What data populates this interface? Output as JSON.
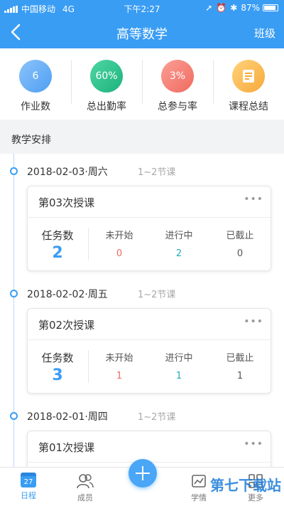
{
  "status_bar": {
    "carrier": "中国移动",
    "network": "4G",
    "time": "下午2:27",
    "battery": "87%"
  },
  "nav": {
    "title": "高等数学",
    "right_label": "班级"
  },
  "stats": [
    {
      "value": "6",
      "label": "作业数",
      "color": "#5aa8f5"
    },
    {
      "value": "60%",
      "label": "总出勤率",
      "color": "#1fbf8a"
    },
    {
      "value": "3%",
      "label": "总参与率",
      "color": "#f27b71"
    },
    {
      "value": "",
      "label": "课程总结",
      "icon": "document-icon",
      "color": "#f9b84a"
    }
  ],
  "section_title": "教学安排",
  "schedule": [
    {
      "date": "2018-02-03·周六",
      "period": "1~2节课",
      "title": "第03次授课",
      "task_label": "任务数",
      "task_count": "2",
      "columns": [
        {
          "label": "未开始",
          "value": "0"
        },
        {
          "label": "进行中",
          "value": "2"
        },
        {
          "label": "已截止",
          "value": "0"
        }
      ]
    },
    {
      "date": "2018-02-02·周五",
      "period": "1~2节课",
      "title": "第02次授课",
      "task_label": "任务数",
      "task_count": "3",
      "columns": [
        {
          "label": "未开始",
          "value": "1"
        },
        {
          "label": "进行中",
          "value": "1"
        },
        {
          "label": "已截止",
          "value": "1"
        }
      ]
    },
    {
      "date": "2018-02-01·周四",
      "period": "1~2节课",
      "title": "第01次授课"
    }
  ],
  "tabs": [
    {
      "label": "日程",
      "icon_text": "27",
      "active": true
    },
    {
      "label": "成员"
    },
    {
      "label": ""
    },
    {
      "label": "学情"
    },
    {
      "label": "更多"
    }
  ],
  "watermark": "第七下载站"
}
